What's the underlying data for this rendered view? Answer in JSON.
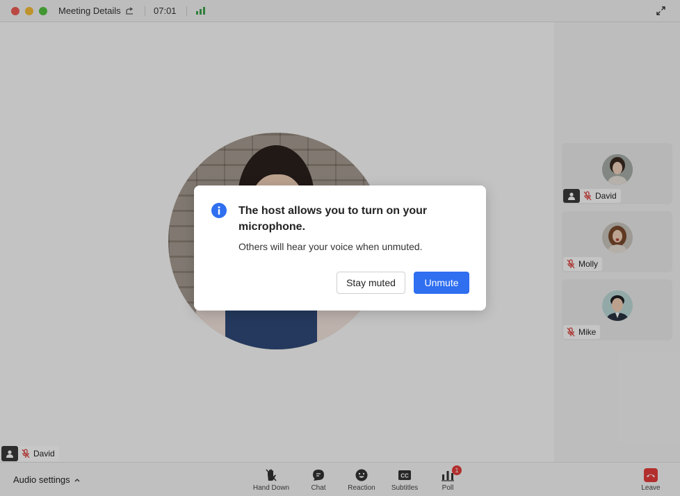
{
  "titlebar": {
    "title": "Meeting Details",
    "timer": "07:01"
  },
  "stage": {
    "speaker_name": "David"
  },
  "participants": [
    {
      "name": "David",
      "has_avatar_badge": true
    },
    {
      "name": "Molly"
    },
    {
      "name": "Mike"
    }
  ],
  "toolbar": {
    "audio_settings": "Audio settings",
    "hand_down": "Hand Down",
    "chat": "Chat",
    "reaction": "Reaction",
    "subtitles": "Subtitles",
    "poll": "Poll",
    "poll_badge": "1",
    "leave": "Leave"
  },
  "dialog": {
    "title": "The host allows you to turn on your microphone.",
    "body": "Others will hear your voice when unmuted.",
    "stay_muted": "Stay muted",
    "unmute": "Unmute"
  },
  "colors": {
    "primary": "#2f6ff0",
    "leave": "#e43d3a",
    "mic_off": "#d9413b",
    "signal": "#3fa34d"
  }
}
